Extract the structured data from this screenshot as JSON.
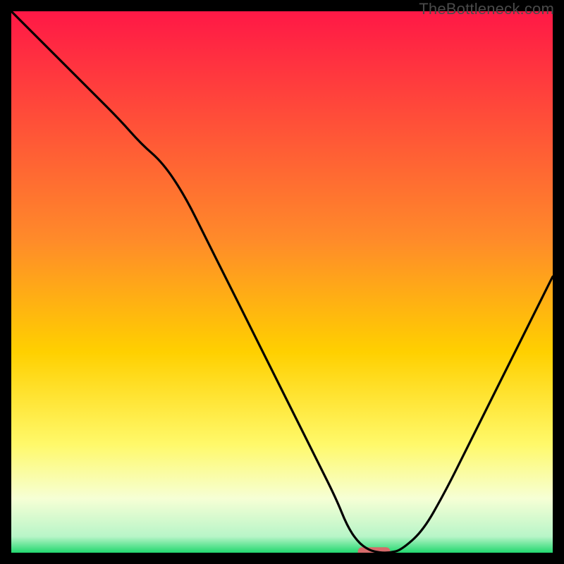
{
  "watermark": "TheBottleneck.com",
  "colors": {
    "frame": "#000000",
    "top": "#ff1846",
    "mid1": "#ff6a2a",
    "mid2": "#ffd000",
    "mid3": "#fff96a",
    "mid4": "#f6ffd5",
    "bottom": "#22d86f",
    "curve": "#000000",
    "marker": "#d66a6a"
  },
  "chart_data": {
    "type": "line",
    "title": "",
    "xlabel": "",
    "ylabel": "",
    "xlim": [
      0,
      100
    ],
    "ylim": [
      0,
      100
    ],
    "x": [
      0,
      5,
      10,
      15,
      20,
      24,
      28,
      32,
      36,
      40,
      44,
      48,
      52,
      56,
      60,
      62,
      64,
      66,
      68,
      70,
      72,
      76,
      80,
      84,
      88,
      92,
      96,
      100
    ],
    "y": [
      100,
      95,
      90,
      85,
      80,
      75.5,
      72,
      66,
      58,
      50,
      42,
      34,
      26,
      18,
      10,
      5,
      2,
      0.5,
      0,
      0,
      0.5,
      4,
      11,
      19,
      27,
      35,
      43,
      51
    ],
    "optimum_marker": {
      "x_start": 64,
      "x_end": 70,
      "y": 0
    }
  }
}
